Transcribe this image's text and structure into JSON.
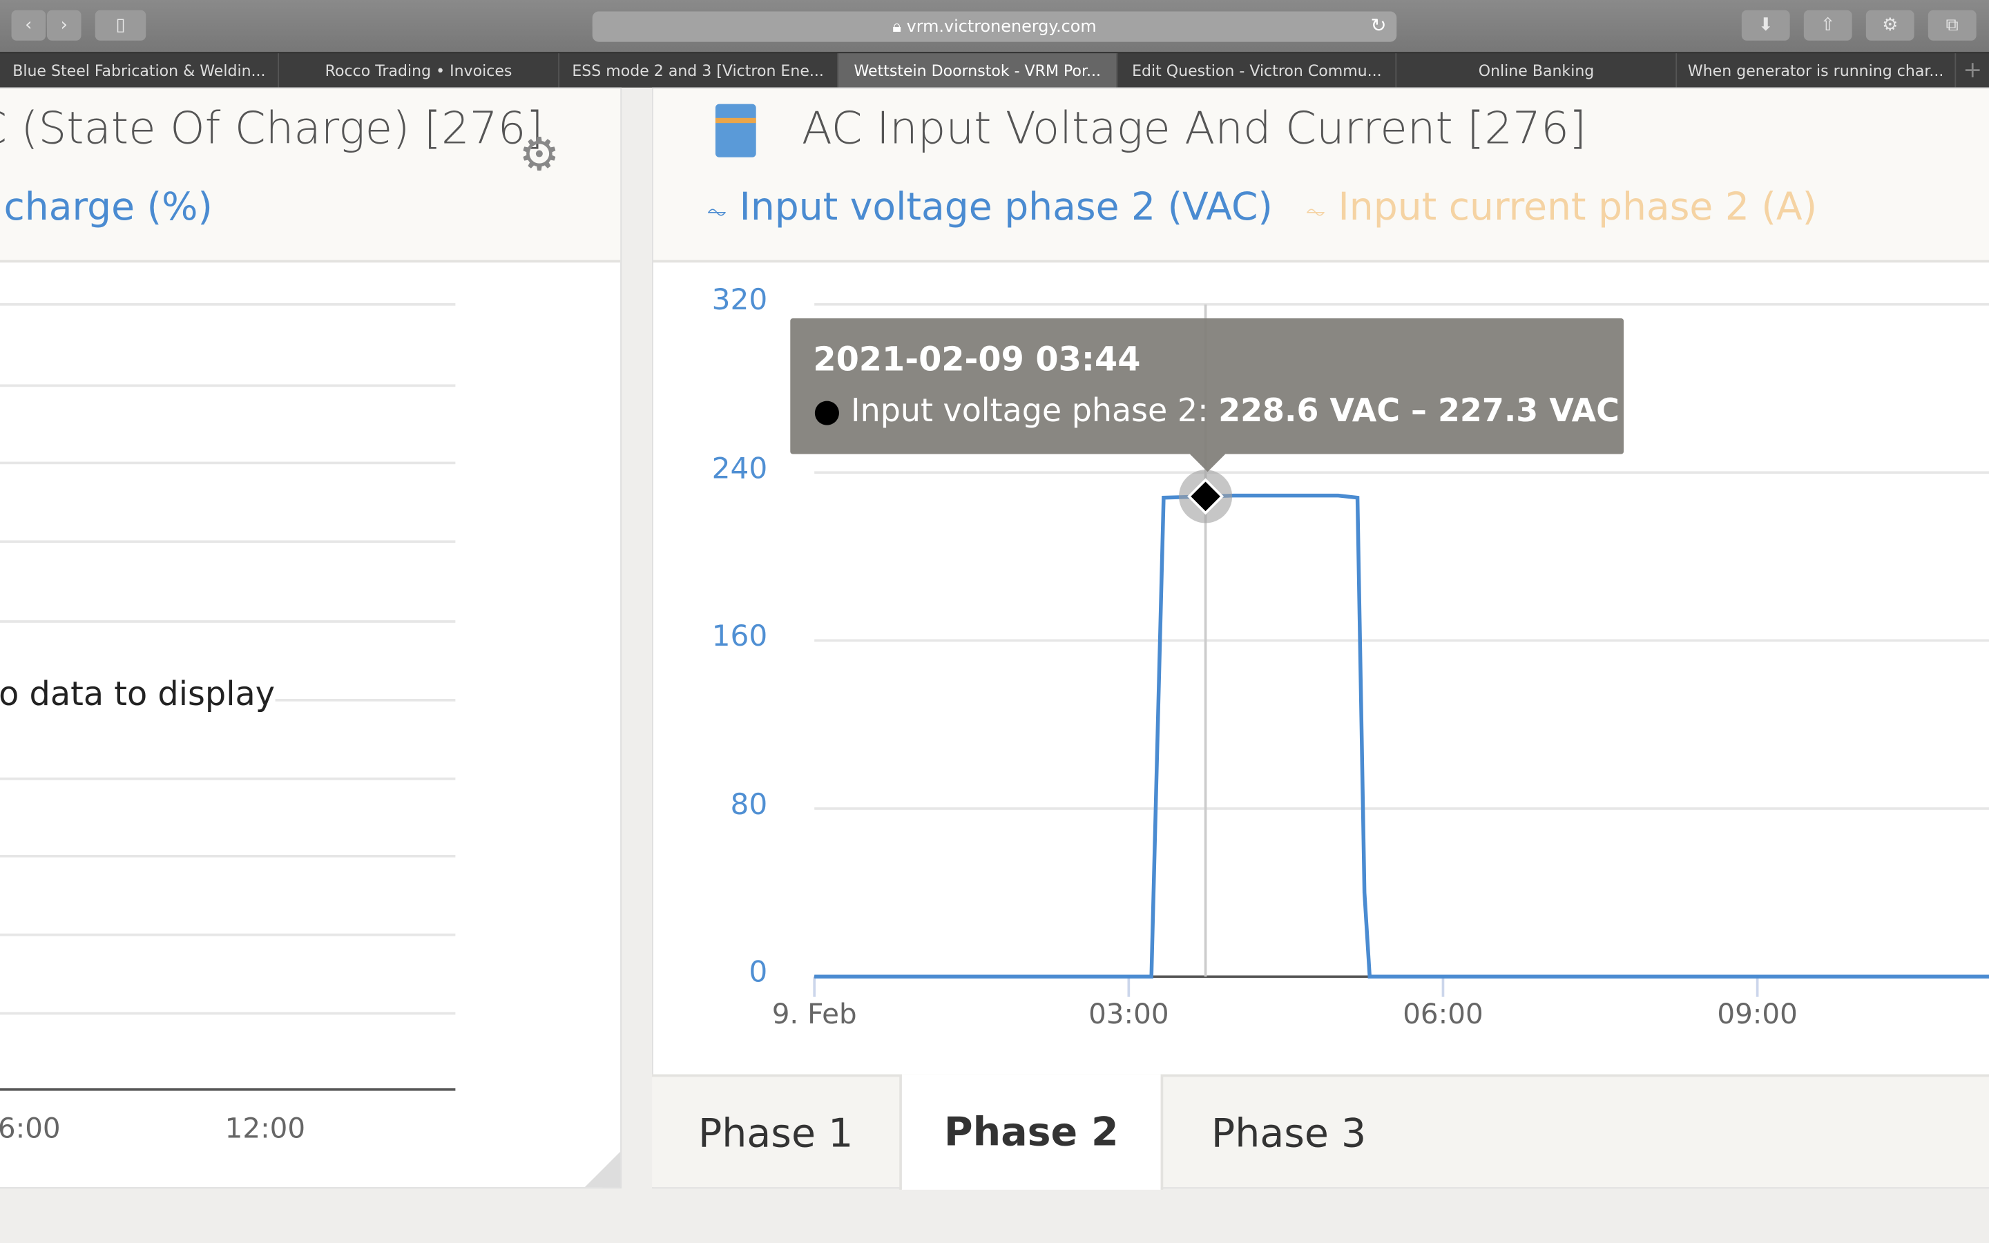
{
  "browser": {
    "url": "vrm.victronenergy.com",
    "tabs": [
      {
        "label": "Blue Steel Fabrication & Weldin...",
        "active": false
      },
      {
        "label": "Rocco Trading • Invoices",
        "active": false
      },
      {
        "label": "ESS mode 2 and 3 [Victron Ene...",
        "active": false
      },
      {
        "label": "Wettstein Doornstok - VRM Por...",
        "active": true
      },
      {
        "label": "Edit Question - Victron Commu...",
        "active": false
      },
      {
        "label": "Online Banking",
        "active": false
      },
      {
        "label": "When generator is running char...",
        "active": false
      }
    ]
  },
  "left_panel": {
    "title": "C (State Of Charge) [276]",
    "legend": "charge (%)",
    "empty_message": "o data to display",
    "x_ticks": [
      "6:00",
      "12:00"
    ]
  },
  "right_panel": {
    "title": "AC Input Voltage And Current [276]",
    "icon": "multiplus-inverter-icon",
    "legend": [
      {
        "label": "Input voltage phase 2 (VAC)",
        "color": "#4a8bd1",
        "enabled": true
      },
      {
        "label": "Input current phase 2 (A)",
        "color": "#f5d3a3",
        "enabled": false
      }
    ],
    "tooltip": {
      "time": "2021-02-09 03:44",
      "series": "Input voltage phase 2: ",
      "value": "228.6 VAC – 227.3 VAC"
    },
    "phase_tabs": [
      {
        "label": "Phase 1",
        "active": false
      },
      {
        "label": "Phase 2",
        "active": true
      },
      {
        "label": "Phase 3",
        "active": false
      }
    ]
  },
  "chart_data": {
    "type": "line",
    "xlabel": "",
    "ylabel": "",
    "ylim": [
      0,
      320
    ],
    "y_ticks": [
      "0",
      "80",
      "160",
      "240",
      "320"
    ],
    "x_ticks": [
      "9. Feb",
      "03:00",
      "06:00",
      "09:00"
    ],
    "grid": true,
    "series": [
      {
        "name": "Input voltage phase 2 (VAC)",
        "color": "#4a8bd1",
        "points": [
          [
            "00:00",
            0
          ],
          [
            "03:13",
            0
          ],
          [
            "03:20",
            228
          ],
          [
            "03:44",
            228.6
          ],
          [
            "04:00",
            229
          ],
          [
            "04:30",
            229
          ],
          [
            "05:00",
            229
          ],
          [
            "05:11",
            228
          ],
          [
            "05:15",
            40
          ],
          [
            "05:18",
            0
          ],
          [
            "11:15",
            0
          ]
        ]
      }
    ]
  }
}
